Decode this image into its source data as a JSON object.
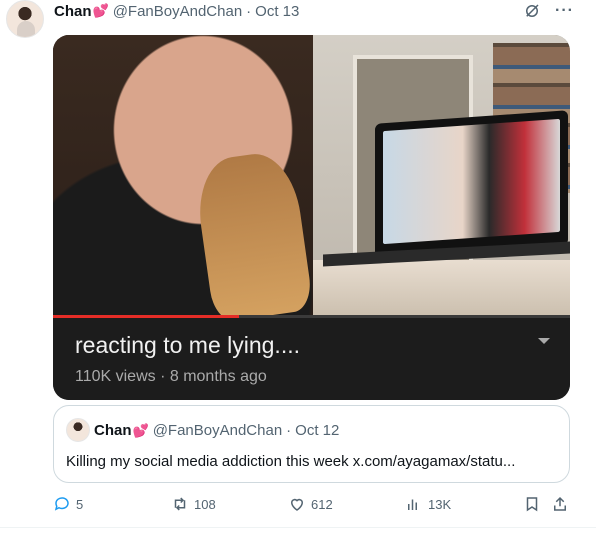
{
  "author": {
    "name": "Chan",
    "emoji": "💕",
    "handle": "@FanBoyAndChan",
    "separator": "·",
    "date": "Oct 13"
  },
  "video": {
    "title": "reacting to me lying....",
    "meta": "110K views · 8 months ago",
    "progress_fraction": 0.36
  },
  "quoted": {
    "name": "Chan",
    "emoji": "💕",
    "handle": "@FanBoyAndChan",
    "separator": "·",
    "date": "Oct 12",
    "text": "Killing my social media addiction this week x.com/ayagamax/statu..."
  },
  "actions": {
    "replies": "5",
    "reposts": "108",
    "likes": "612",
    "views": "13K"
  },
  "colors": {
    "accent_heart": "#e0245e",
    "muted_text": "#536471",
    "progress_red": "#e52d27"
  }
}
